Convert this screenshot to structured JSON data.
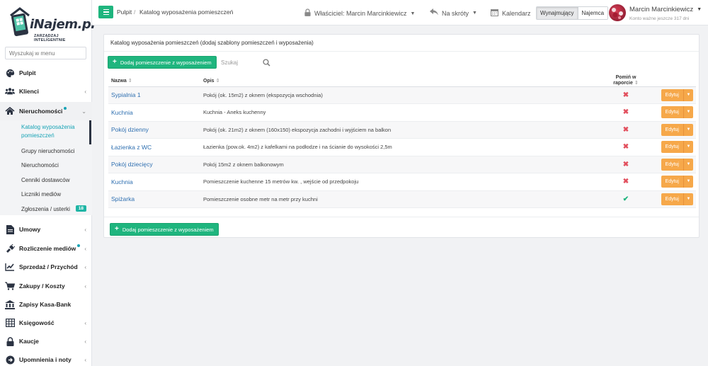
{
  "logo": {
    "name": "iNajem.pl",
    "tagline": "ZARZĄDZAJ INTELIGENTNIE"
  },
  "sidebar": {
    "search_placeholder": "Wyszukaj w menu",
    "items": [
      {
        "label": "Pulpit",
        "icon": "palette-icon"
      },
      {
        "label": "Klienci",
        "icon": "users-icon"
      },
      {
        "label": "Nieruchomości",
        "icon": "home-icon"
      },
      {
        "label": "Umowy",
        "icon": "document-icon"
      },
      {
        "label": "Rozliczenie mediów",
        "icon": "plug-icon"
      },
      {
        "label": "Sprzedaż / Przychód",
        "icon": "chart-line-icon"
      },
      {
        "label": "Zakupy / Koszty",
        "icon": "cart-icon"
      },
      {
        "label": "Zapisy Kasa-Bank",
        "icon": "bank-icon"
      },
      {
        "label": "Księgowość",
        "icon": "table-icon"
      },
      {
        "label": "Kaucje",
        "icon": "lock-icon"
      },
      {
        "label": "Upomnienia i noty",
        "icon": "arrow-circle-icon"
      }
    ],
    "subitems": [
      {
        "label": "Katalog wyposażenia",
        "label2": "pomieszczeń"
      },
      {
        "label": "Grupy nieruchomości"
      },
      {
        "label": "Nieruchomości"
      },
      {
        "label": "Cenniki dostawców"
      },
      {
        "label": "Liczniki mediów"
      },
      {
        "label": "Zgłoszenia / usterki",
        "badge": "18"
      }
    ],
    "accent": "#17a3b5"
  },
  "topbar": {
    "breadcrumb": [
      "Pulpit",
      "/",
      "Katalog wyposażenia pomieszczeń"
    ],
    "owner": "Właściciel: Marcin Marcinkiewicz",
    "shortcuts": "Na skróty",
    "calendar": "Kalendarz",
    "toggle": [
      "Wynajmujący",
      "Najemca"
    ],
    "user_name": "Marcin Marcinkiewicz",
    "user_sub": "Konto ważne jeszcze 317 dni"
  },
  "panel": {
    "title": "Katalog wyposażenia pomieszczeń (dodaj szablony pomieszczeń i wyposażenia)",
    "add_label": "Dodaj pomieszczenie z wyposażeniem",
    "search_placeholder": "Szukaj",
    "columns": [
      "Nazwa",
      "Opis",
      "Pomiń w raporcie"
    ],
    "edit_label": "Edytuj",
    "rows": [
      {
        "name": "Sypialnia 1",
        "desc": "Pokój (ok. 15m2) z oknem (ekspozycja wschodnia)",
        "skip": false
      },
      {
        "name": "Kuchnia",
        "desc": "Kuchnia - Aneks kuchenny",
        "skip": false
      },
      {
        "name": "Pokój dzienny",
        "desc": "Pokój (ok. 21m2) z oknem (160x150) ekspozycja zachodni i wyjściem na balkon",
        "skip": false
      },
      {
        "name": "Łazienka z WC",
        "desc": "Łazienka (pow.ok. 4m2) z kafelkami na podłodze i na ścianie do wysokości 2,5m",
        "skip": false
      },
      {
        "name": "Pokój dziecięcy",
        "desc": "Pokój 15m2 z oknem balkonowym",
        "skip": false
      },
      {
        "name": "Kuchnia",
        "desc": "Pomieszczenie kuchenne 15 metrów kw. , wejście od przedpokoju",
        "skip": false
      },
      {
        "name": "Spiżarka",
        "desc": "Pomieszczenie osobne metr na metr przy kuchni",
        "skip": true
      }
    ],
    "colors": {
      "green": "#1fb57e",
      "orange": "#f6a84a",
      "red": "#e2505e",
      "link": "#2e6fb0"
    }
  }
}
